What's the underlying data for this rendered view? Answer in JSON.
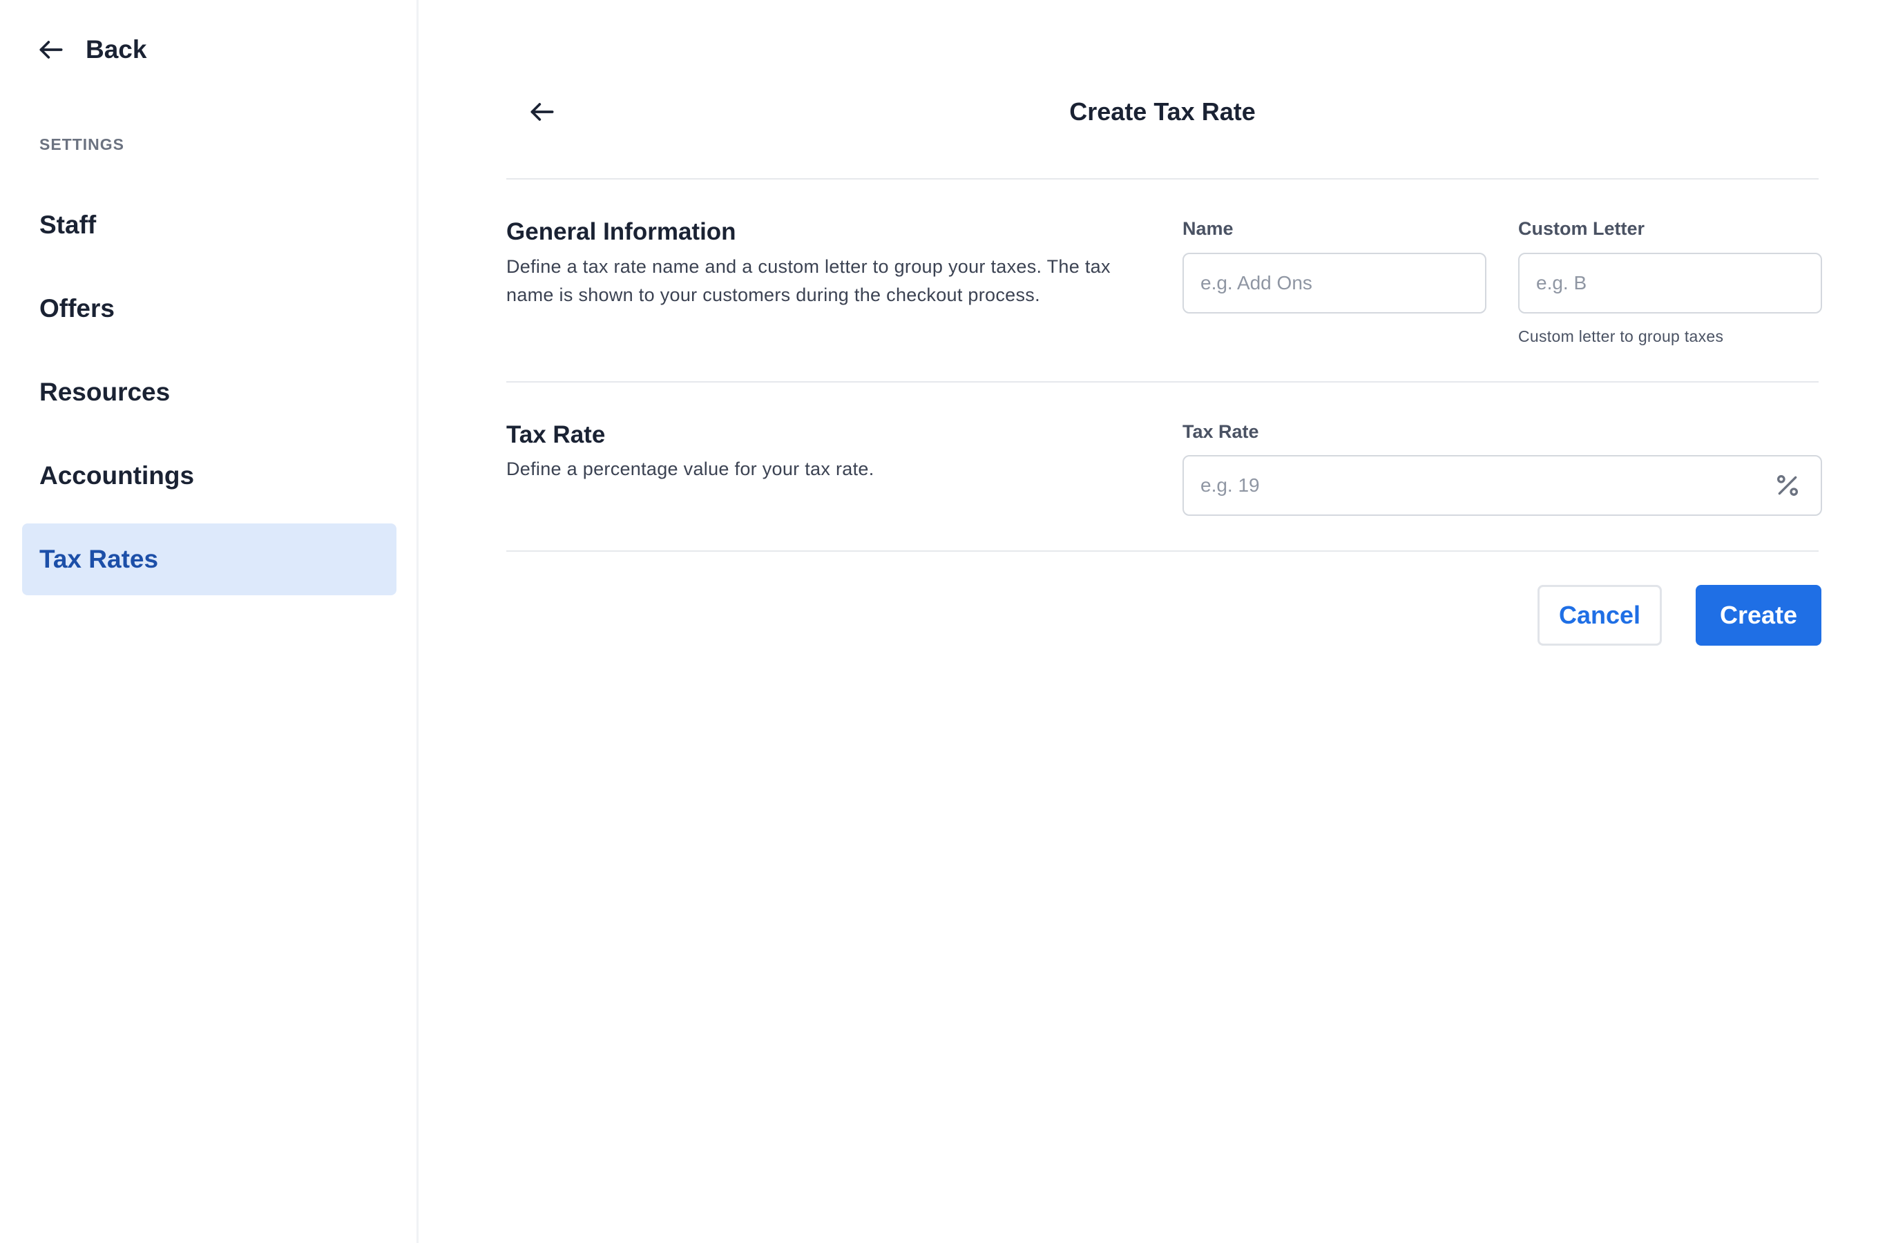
{
  "sidebar": {
    "back_label": "Back",
    "section_label": "SETTINGS",
    "items": [
      {
        "label": "Staff"
      },
      {
        "label": "Offers"
      },
      {
        "label": "Resources"
      },
      {
        "label": "Accountings"
      },
      {
        "label": "Tax Rates",
        "active": true
      }
    ]
  },
  "header": {
    "title": "Create Tax Rate"
  },
  "general": {
    "title": "General Information",
    "description": "Define a tax rate name and a custom letter to group your taxes. The tax name is shown to your customers during the checkout process.",
    "name_label": "Name",
    "name_placeholder": "e.g. Add Ons",
    "name_value": "",
    "letter_label": "Custom Letter",
    "letter_placeholder": "e.g. B",
    "letter_value": "",
    "letter_hint": "Custom letter to group taxes"
  },
  "tax_rate": {
    "title": "Tax Rate",
    "description": "Define a percentage value for your tax rate.",
    "label": "Tax Rate",
    "placeholder": "e.g. 19",
    "value": "",
    "unit_icon": "percent-icon"
  },
  "actions": {
    "cancel_label": "Cancel",
    "create_label": "Create"
  },
  "colors": {
    "accent": "#1f6fe5",
    "active_nav_bg": "#dde9fb",
    "active_nav_text": "#1c4fa8"
  }
}
